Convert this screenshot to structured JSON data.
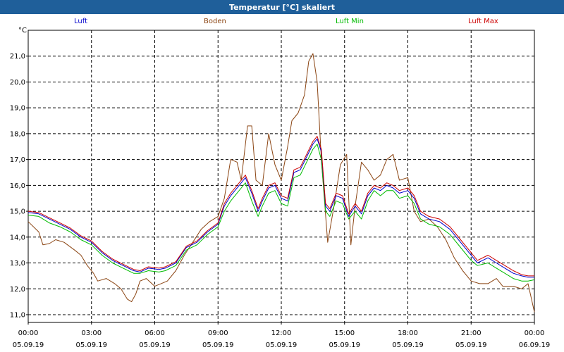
{
  "window": {
    "title": "Temperatur [°C] skaliert"
  },
  "unit_label": "°C",
  "legend": [
    {
      "name": "Luft",
      "color": "#0000cc"
    },
    {
      "name": "Boden",
      "color": "#8b4513"
    },
    {
      "name": "Luft Min",
      "color": "#00bb00"
    },
    {
      "name": "Luft Max",
      "color": "#cc0000"
    }
  ],
  "chart_data": {
    "type": "line",
    "title": "Temperatur [°C] skaliert",
    "ylabel": "°C",
    "xlim": [
      0,
      24
    ],
    "ylim": [
      10.7,
      22.0
    ],
    "grid": true,
    "legend_position": "top",
    "y_ticks": [
      "11,0",
      "12,0",
      "13,0",
      "14,0",
      "15,0",
      "16,0",
      "17,0",
      "18,0",
      "19,0",
      "20,0",
      "21,0"
    ],
    "y_tick_values": [
      11,
      12,
      13,
      14,
      15,
      16,
      17,
      18,
      19,
      20,
      21
    ],
    "x_ticks": [
      {
        "time": "00:00",
        "date": "05.09.19",
        "hour": 0
      },
      {
        "time": "03:00",
        "date": "05.09.19",
        "hour": 3
      },
      {
        "time": "06:00",
        "date": "05.09.19",
        "hour": 6
      },
      {
        "time": "09:00",
        "date": "05.09.19",
        "hour": 9
      },
      {
        "time": "12:00",
        "date": "05.09.19",
        "hour": 12
      },
      {
        "time": "15:00",
        "date": "05.09.19",
        "hour": 15
      },
      {
        "time": "18:00",
        "date": "05.09.19",
        "hour": 18
      },
      {
        "time": "21:00",
        "date": "05.09.19",
        "hour": 21
      },
      {
        "time": "00:00",
        "date": "06.09.19",
        "hour": 24
      }
    ],
    "series": [
      {
        "name": "Luft",
        "color": "#0000cc",
        "points": [
          [
            0,
            14.95
          ],
          [
            0.5,
            14.9
          ],
          [
            1,
            14.7
          ],
          [
            1.5,
            14.5
          ],
          [
            2,
            14.3
          ],
          [
            2.5,
            14.0
          ],
          [
            3,
            13.8
          ],
          [
            3.5,
            13.4
          ],
          [
            4,
            13.1
          ],
          [
            4.5,
            12.9
          ],
          [
            5,
            12.7
          ],
          [
            5.3,
            12.65
          ],
          [
            5.7,
            12.8
          ],
          [
            6.2,
            12.75
          ],
          [
            6.5,
            12.8
          ],
          [
            7,
            13.0
          ],
          [
            7.5,
            13.6
          ],
          [
            8,
            13.8
          ],
          [
            8.5,
            14.2
          ],
          [
            9,
            14.5
          ],
          [
            9.3,
            15.2
          ],
          [
            9.6,
            15.6
          ],
          [
            10,
            16.0
          ],
          [
            10.3,
            16.3
          ],
          [
            10.6,
            15.7
          ],
          [
            10.9,
            15.0
          ],
          [
            11.1,
            15.4
          ],
          [
            11.4,
            15.9
          ],
          [
            11.7,
            16.0
          ],
          [
            12,
            15.5
          ],
          [
            12.3,
            15.4
          ],
          [
            12.6,
            16.5
          ],
          [
            12.9,
            16.6
          ],
          [
            13.2,
            17.1
          ],
          [
            13.5,
            17.6
          ],
          [
            13.7,
            17.8
          ],
          [
            13.9,
            17.3
          ],
          [
            14.1,
            15.2
          ],
          [
            14.3,
            15.0
          ],
          [
            14.6,
            15.6
          ],
          [
            14.9,
            15.5
          ],
          [
            15.2,
            14.8
          ],
          [
            15.5,
            15.2
          ],
          [
            15.8,
            14.9
          ],
          [
            16.1,
            15.6
          ],
          [
            16.4,
            15.9
          ],
          [
            16.7,
            15.8
          ],
          [
            17.0,
            16.0
          ],
          [
            17.3,
            15.9
          ],
          [
            17.6,
            15.7
          ],
          [
            18.0,
            15.8
          ],
          [
            18.3,
            15.5
          ],
          [
            18.6,
            14.9
          ],
          [
            19,
            14.7
          ],
          [
            19.5,
            14.6
          ],
          [
            20,
            14.3
          ],
          [
            20.5,
            13.8
          ],
          [
            21,
            13.3
          ],
          [
            21.3,
            13.0
          ],
          [
            21.8,
            13.2
          ],
          [
            22.2,
            13.0
          ],
          [
            22.6,
            12.8
          ],
          [
            23,
            12.6
          ],
          [
            23.4,
            12.5
          ],
          [
            23.7,
            12.45
          ],
          [
            24,
            12.45
          ]
        ]
      },
      {
        "name": "Boden",
        "color": "#8b4513",
        "points": [
          [
            0,
            14.6
          ],
          [
            0.5,
            14.2
          ],
          [
            0.7,
            13.7
          ],
          [
            1,
            13.75
          ],
          [
            1.3,
            13.9
          ],
          [
            1.7,
            13.8
          ],
          [
            2.2,
            13.5
          ],
          [
            2.5,
            13.3
          ],
          [
            2.8,
            12.9
          ],
          [
            3.1,
            12.6
          ],
          [
            3.3,
            12.3
          ],
          [
            3.7,
            12.4
          ],
          [
            4.1,
            12.2
          ],
          [
            4.4,
            12.0
          ],
          [
            4.7,
            11.6
          ],
          [
            4.9,
            11.5
          ],
          [
            5.1,
            11.8
          ],
          [
            5.3,
            12.3
          ],
          [
            5.6,
            12.4
          ],
          [
            6.0,
            12.1
          ],
          [
            6.3,
            12.2
          ],
          [
            6.6,
            12.3
          ],
          [
            7,
            12.7
          ],
          [
            7.4,
            13.3
          ],
          [
            7.8,
            13.8
          ],
          [
            8.2,
            14.3
          ],
          [
            8.6,
            14.6
          ],
          [
            9,
            14.8
          ],
          [
            9.3,
            15.5
          ],
          [
            9.6,
            17.0
          ],
          [
            9.9,
            16.9
          ],
          [
            10.1,
            16.2
          ],
          [
            10.4,
            18.3
          ],
          [
            10.6,
            18.3
          ],
          [
            10.8,
            16.2
          ],
          [
            11.1,
            16.0
          ],
          [
            11.4,
            18.0
          ],
          [
            11.7,
            16.8
          ],
          [
            12.0,
            16.2
          ],
          [
            12.3,
            17.5
          ],
          [
            12.5,
            18.5
          ],
          [
            12.8,
            18.8
          ],
          [
            13.1,
            19.5
          ],
          [
            13.3,
            20.8
          ],
          [
            13.5,
            21.1
          ],
          [
            13.7,
            20.0
          ],
          [
            13.9,
            17.0
          ],
          [
            14.2,
            13.8
          ],
          [
            14.5,
            15.2
          ],
          [
            14.8,
            16.8
          ],
          [
            15.1,
            17.2
          ],
          [
            15.3,
            13.7
          ],
          [
            15.5,
            15.2
          ],
          [
            15.8,
            16.9
          ],
          [
            16.1,
            16.6
          ],
          [
            16.4,
            16.2
          ],
          [
            16.7,
            16.4
          ],
          [
            17.0,
            17.0
          ],
          [
            17.3,
            17.2
          ],
          [
            17.6,
            16.2
          ],
          [
            18.0,
            16.3
          ],
          [
            18.3,
            15.0
          ],
          [
            18.6,
            14.6
          ],
          [
            19,
            14.7
          ],
          [
            19.4,
            14.4
          ],
          [
            19.8,
            13.9
          ],
          [
            20.2,
            13.2
          ],
          [
            20.6,
            12.7
          ],
          [
            21,
            12.3
          ],
          [
            21.4,
            12.2
          ],
          [
            21.8,
            12.2
          ],
          [
            22.2,
            12.4
          ],
          [
            22.5,
            12.1
          ],
          [
            23.0,
            12.1
          ],
          [
            23.4,
            12.0
          ],
          [
            23.7,
            12.2
          ],
          [
            24,
            11.1
          ]
        ]
      },
      {
        "name": "Luft Min",
        "color": "#00bb00",
        "points": [
          [
            0,
            14.85
          ],
          [
            0.5,
            14.8
          ],
          [
            1,
            14.55
          ],
          [
            1.5,
            14.4
          ],
          [
            2,
            14.2
          ],
          [
            2.5,
            13.9
          ],
          [
            3,
            13.7
          ],
          [
            3.5,
            13.3
          ],
          [
            4,
            13.0
          ],
          [
            4.5,
            12.8
          ],
          [
            5,
            12.6
          ],
          [
            5.3,
            12.6
          ],
          [
            5.7,
            12.7
          ],
          [
            6.2,
            12.65
          ],
          [
            6.5,
            12.7
          ],
          [
            7,
            12.9
          ],
          [
            7.5,
            13.5
          ],
          [
            8,
            13.7
          ],
          [
            8.5,
            14.1
          ],
          [
            9,
            14.4
          ],
          [
            9.3,
            15.0
          ],
          [
            9.6,
            15.4
          ],
          [
            10,
            15.8
          ],
          [
            10.3,
            16.1
          ],
          [
            10.6,
            15.4
          ],
          [
            10.9,
            14.8
          ],
          [
            11.1,
            15.2
          ],
          [
            11.4,
            15.7
          ],
          [
            11.7,
            15.8
          ],
          [
            12,
            15.3
          ],
          [
            12.3,
            15.2
          ],
          [
            12.6,
            16.3
          ],
          [
            12.9,
            16.4
          ],
          [
            13.2,
            16.9
          ],
          [
            13.5,
            17.4
          ],
          [
            13.7,
            17.6
          ],
          [
            13.9,
            17.0
          ],
          [
            14.1,
            15.0
          ],
          [
            14.3,
            14.8
          ],
          [
            14.6,
            15.4
          ],
          [
            14.9,
            15.3
          ],
          [
            15.2,
            14.7
          ],
          [
            15.5,
            15.0
          ],
          [
            15.8,
            14.7
          ],
          [
            16.1,
            15.4
          ],
          [
            16.4,
            15.8
          ],
          [
            16.7,
            15.6
          ],
          [
            17.0,
            15.8
          ],
          [
            17.3,
            15.8
          ],
          [
            17.6,
            15.5
          ],
          [
            18.0,
            15.6
          ],
          [
            18.3,
            15.3
          ],
          [
            18.6,
            14.7
          ],
          [
            19,
            14.5
          ],
          [
            19.5,
            14.4
          ],
          [
            20,
            14.1
          ],
          [
            20.5,
            13.6
          ],
          [
            21,
            13.1
          ],
          [
            21.3,
            12.9
          ],
          [
            21.8,
            13.0
          ],
          [
            22.2,
            12.8
          ],
          [
            22.6,
            12.6
          ],
          [
            23,
            12.4
          ],
          [
            23.4,
            12.3
          ],
          [
            23.7,
            12.3
          ],
          [
            24,
            12.35
          ]
        ]
      },
      {
        "name": "Luft Max",
        "color": "#cc0000",
        "points": [
          [
            0,
            15.0
          ],
          [
            0.5,
            14.95
          ],
          [
            1,
            14.75
          ],
          [
            1.5,
            14.55
          ],
          [
            2,
            14.35
          ],
          [
            2.5,
            14.05
          ],
          [
            3,
            13.85
          ],
          [
            3.5,
            13.45
          ],
          [
            4,
            13.15
          ],
          [
            4.5,
            12.95
          ],
          [
            5,
            12.75
          ],
          [
            5.3,
            12.7
          ],
          [
            5.7,
            12.85
          ],
          [
            6.2,
            12.8
          ],
          [
            6.5,
            12.85
          ],
          [
            7,
            13.05
          ],
          [
            7.5,
            13.65
          ],
          [
            8,
            13.85
          ],
          [
            8.5,
            14.25
          ],
          [
            9,
            14.55
          ],
          [
            9.3,
            15.3
          ],
          [
            9.6,
            15.7
          ],
          [
            10,
            16.1
          ],
          [
            10.3,
            16.4
          ],
          [
            10.6,
            15.8
          ],
          [
            10.9,
            15.1
          ],
          [
            11.1,
            15.5
          ],
          [
            11.4,
            16.0
          ],
          [
            11.7,
            16.1
          ],
          [
            12,
            15.6
          ],
          [
            12.3,
            15.5
          ],
          [
            12.6,
            16.6
          ],
          [
            12.9,
            16.7
          ],
          [
            13.2,
            17.2
          ],
          [
            13.5,
            17.7
          ],
          [
            13.7,
            17.9
          ],
          [
            13.9,
            17.4
          ],
          [
            14.1,
            15.3
          ],
          [
            14.3,
            15.1
          ],
          [
            14.6,
            15.7
          ],
          [
            14.9,
            15.6
          ],
          [
            15.2,
            14.9
          ],
          [
            15.5,
            15.3
          ],
          [
            15.8,
            15.0
          ],
          [
            16.1,
            15.7
          ],
          [
            16.4,
            16.0
          ],
          [
            16.7,
            15.9
          ],
          [
            17.0,
            16.1
          ],
          [
            17.3,
            16.0
          ],
          [
            17.6,
            15.8
          ],
          [
            18.0,
            15.9
          ],
          [
            18.3,
            15.6
          ],
          [
            18.6,
            15.0
          ],
          [
            19,
            14.8
          ],
          [
            19.5,
            14.7
          ],
          [
            20,
            14.4
          ],
          [
            20.5,
            13.9
          ],
          [
            21,
            13.4
          ],
          [
            21.3,
            13.1
          ],
          [
            21.8,
            13.3
          ],
          [
            22.2,
            13.1
          ],
          [
            22.6,
            12.9
          ],
          [
            23,
            12.7
          ],
          [
            23.4,
            12.55
          ],
          [
            23.7,
            12.5
          ],
          [
            24,
            12.5
          ]
        ]
      }
    ]
  }
}
